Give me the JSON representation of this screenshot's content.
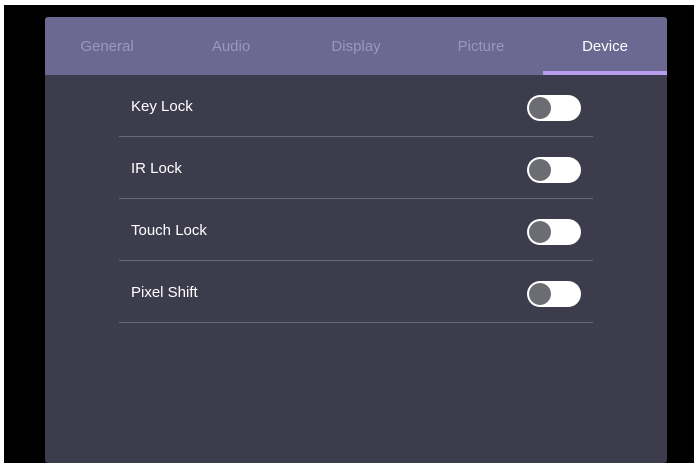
{
  "tabs": [
    {
      "label": "General",
      "active": false
    },
    {
      "label": "Audio",
      "active": false
    },
    {
      "label": "Display",
      "active": false
    },
    {
      "label": "Picture",
      "active": false
    },
    {
      "label": "Device",
      "active": true
    }
  ],
  "settings": [
    {
      "label": "Key Lock",
      "enabled": false
    },
    {
      "label": "IR Lock",
      "enabled": false
    },
    {
      "label": "Touch Lock",
      "enabled": false
    },
    {
      "label": "Pixel Shift",
      "enabled": false
    }
  ],
  "colors": {
    "tab_bar": "#6b6891",
    "panel": "#3d3c4d",
    "active_indicator": "#b79cf0",
    "toggle_track_off": "#ffffff",
    "toggle_knob_off": "#6b6d73"
  }
}
